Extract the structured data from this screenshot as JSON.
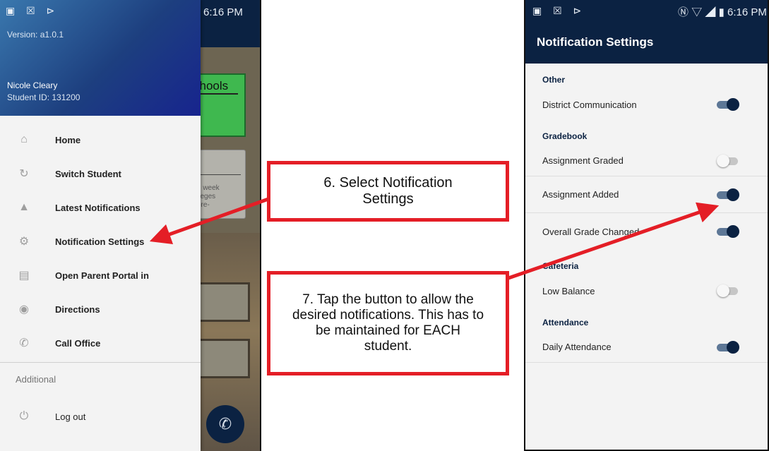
{
  "left_phone": {
    "status_bar": {
      "left_icons": "▣ ☒ ⊳",
      "time": "6:16 PM"
    },
    "drawer": {
      "version": "Version: a1.0.1",
      "user_name": "Nicole Cleary",
      "student_id": "Student ID: 131200",
      "menu_items": [
        {
          "label": "Home",
          "icon": "home-icon"
        },
        {
          "label": "Switch Student",
          "icon": "switch-icon"
        },
        {
          "label": "Latest Notifications",
          "icon": "bell-icon"
        },
        {
          "label": "Notification Settings",
          "icon": "gear-icon"
        },
        {
          "label": "Open Parent Portal in",
          "icon": "browser-icon"
        },
        {
          "label": "Directions",
          "icon": "map-pin-icon"
        },
        {
          "label": "Call Office",
          "icon": "phone-icon"
        }
      ],
      "section_label": "Additional",
      "logout_label": "Log out"
    },
    "background": {
      "card_title": "chools",
      "card_text": [
        "d week",
        "lleges",
        "ore-"
      ]
    }
  },
  "right_phone": {
    "status_bar": {
      "left_icons": "▣ ☒ ⊳",
      "time": "6:16 PM"
    },
    "title": "Notification Settings",
    "groups": [
      {
        "header": "Other",
        "items": [
          {
            "label": "District Communication",
            "enabled": true
          }
        ]
      },
      {
        "header": "Gradebook",
        "items": [
          {
            "label": "Assignment Graded",
            "enabled": false
          },
          {
            "label": "Assignment Added",
            "enabled": true
          },
          {
            "label": "Overall Grade Changed",
            "enabled": true
          }
        ]
      },
      {
        "header": "Cafeteria",
        "items": [
          {
            "label": "Low Balance",
            "enabled": false
          }
        ]
      },
      {
        "header": "Attendance",
        "items": [
          {
            "label": "Daily Attendance",
            "enabled": true
          }
        ]
      }
    ]
  },
  "callouts": {
    "step6": "6. Select Notification Settings",
    "step7": "7. Tap the button to allow the desired notifications. This has to be maintained for EACH student."
  },
  "colors": {
    "brand_navy": "#0b2242",
    "callout_red": "#e41e26",
    "toggle_on": "#0b2242",
    "toggle_off": "#c6c6c6"
  }
}
